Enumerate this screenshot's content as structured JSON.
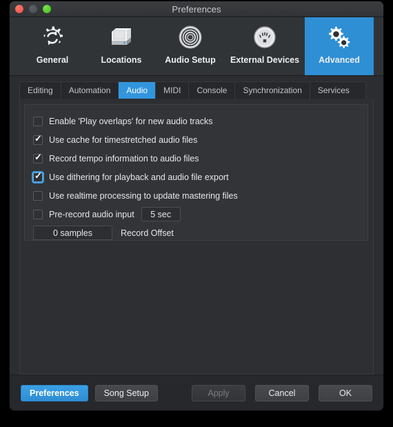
{
  "window": {
    "title": "Preferences",
    "traffic_lights": [
      "close",
      "minimize",
      "zoom"
    ]
  },
  "accent_color": "#3296de",
  "toolbar": {
    "items": [
      {
        "label": "General",
        "icon": "gear-refresh-icon",
        "selected": false
      },
      {
        "label": "Locations",
        "icon": "hard-drive-icon",
        "selected": false
      },
      {
        "label": "Audio Setup",
        "icon": "speaker-icon",
        "selected": false
      },
      {
        "label": "External Devices",
        "icon": "midi-din-connector-icon",
        "selected": false
      },
      {
        "label": "Advanced",
        "icon": "double-gear-icon",
        "selected": true
      }
    ]
  },
  "tabs": [
    {
      "label": "Editing",
      "active": false
    },
    {
      "label": "Automation",
      "active": false
    },
    {
      "label": "Audio",
      "active": true
    },
    {
      "label": "MIDI",
      "active": false
    },
    {
      "label": "Console",
      "active": false
    },
    {
      "label": "Synchronization",
      "active": false
    },
    {
      "label": "Services",
      "active": false
    }
  ],
  "audio_options": [
    {
      "label": "Enable 'Play overlaps' for new audio tracks",
      "checked": false,
      "focused": false
    },
    {
      "label": "Use cache for timestretched audio files",
      "checked": true,
      "focused": false
    },
    {
      "label": "Record tempo information to audio files",
      "checked": true,
      "focused": false
    },
    {
      "label": "Use dithering for playback and audio file export",
      "checked": true,
      "focused": true
    },
    {
      "label": "Use realtime processing to update mastering files",
      "checked": false,
      "focused": false
    },
    {
      "label": "Pre-record audio input",
      "checked": false,
      "focused": false
    }
  ],
  "fields": {
    "prerecord_seconds": "5 sec",
    "record_offset_value": "0 samples",
    "record_offset_label": "Record Offset"
  },
  "footer": {
    "preferences_label": "Preferences",
    "song_setup_label": "Song Setup",
    "apply_label": "Apply",
    "cancel_label": "Cancel",
    "ok_label": "OK"
  }
}
